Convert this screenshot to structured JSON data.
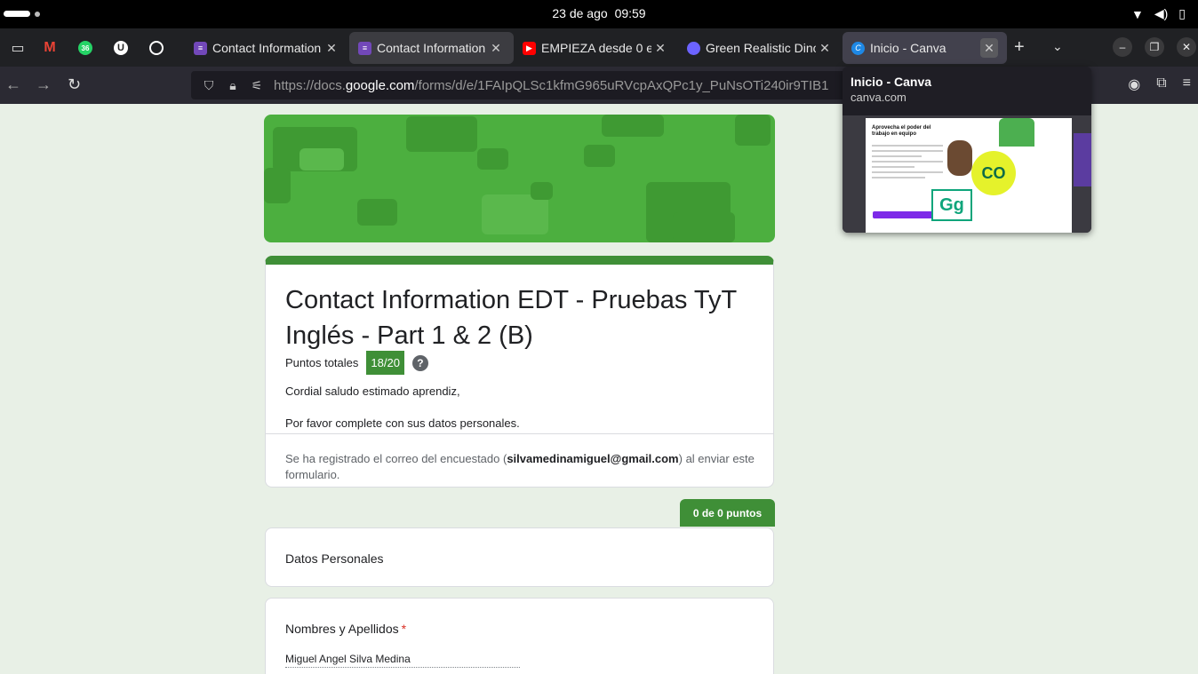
{
  "system": {
    "date": "23 de ago",
    "time": "09:59"
  },
  "tabs": [
    {
      "label": "Contact Information",
      "icon": "google-forms-icon",
      "selected": false
    },
    {
      "label": "Contact Information",
      "icon": "google-forms-icon",
      "selected": true
    },
    {
      "label": "EMPIEZA desde 0 e",
      "icon": "youtube-icon",
      "selected": false
    },
    {
      "label": "Green Realistic Dino",
      "icon": "extension-icon",
      "selected": false
    },
    {
      "label": "Inicio - Canva",
      "icon": "canva-icon",
      "selected": false
    }
  ],
  "pinned": [
    "gmail-icon",
    "whatsapp-icon",
    "udemy-icon",
    "chatgpt-icon"
  ],
  "whatsapp_count": "36",
  "address": {
    "prefix": "https://docs.",
    "domain": "google.com",
    "path": "/forms/d/e/1FAIpQLSc1kfmG965uRVcpAxQPc1y_PuNsOTi240ir9TIB1"
  },
  "preview": {
    "title": "Inicio - Canva",
    "domain": "canva.com",
    "image_heading": "Aprovecha el poder del trabajo en equipo",
    "co_text": "CO",
    "gg_text": "Gg"
  },
  "form": {
    "title": "Contact Information EDT - Pruebas TyT Inglés - Part 1 & 2 (B)",
    "total_points_label": "Puntos totales",
    "score": "18/20",
    "desc_line1": "Cordial saludo estimado aprendiz,",
    "desc_line2": "Por favor complete con sus datos personales.",
    "email_prefix": "Se ha registrado el correo del encuestado (",
    "email": "silvamedinamiguel@gmail.com",
    "email_suffix": ") al enviar este formulario.",
    "section_points": "0 de 0 puntos",
    "section_title": "Datos Personales",
    "question_label": "Nombres y Apellidos",
    "required_mark": "*",
    "answer": "Miguel Angel Silva Medina"
  },
  "colors": {
    "form_accent": "#3f8f37",
    "banner": "#4caf3f",
    "required": "#d93025"
  }
}
